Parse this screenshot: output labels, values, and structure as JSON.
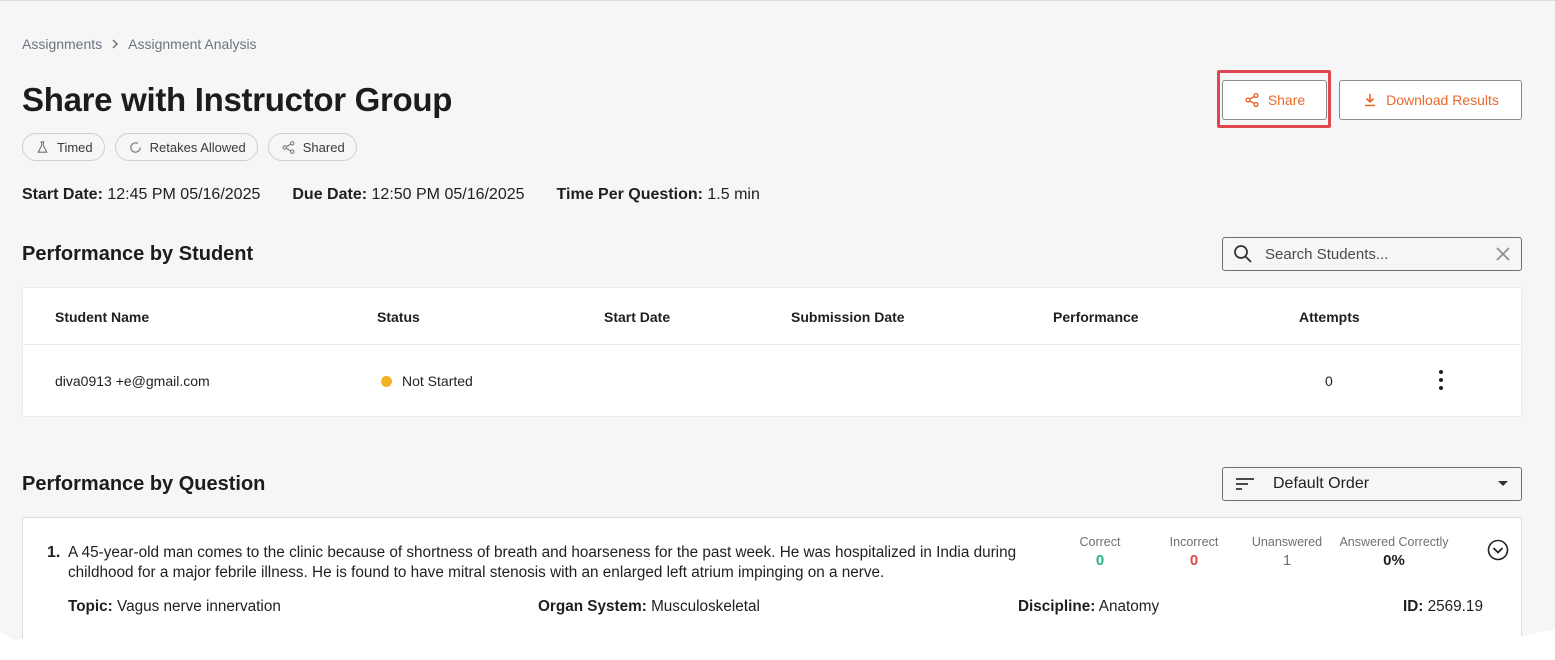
{
  "breadcrumb": {
    "parent": "Assignments",
    "separator": ">",
    "current": "Assignment Analysis"
  },
  "header": {
    "title": "Share with Instructor Group",
    "share_label": "Share",
    "download_label": "Download Results"
  },
  "chips": [
    {
      "label": "Timed",
      "icon": "flask-icon"
    },
    {
      "label": "Retakes Allowed",
      "icon": "refresh-icon"
    },
    {
      "label": "Shared",
      "icon": "share-icon"
    }
  ],
  "meta": {
    "start_label": "Start Date:",
    "start_value": "12:45 PM 05/16/2025",
    "due_label": "Due Date:",
    "due_value": "12:50 PM 05/16/2025",
    "tpq_label": "Time Per Question:",
    "tpq_value": "1.5 min"
  },
  "students_section": {
    "title": "Performance by Student",
    "search_placeholder": "Search Students...",
    "columns": [
      "Student Name",
      "Status",
      "Start Date",
      "Submission Date",
      "Performance",
      "Attempts"
    ],
    "rows": [
      {
        "name": "diva0913 +e@gmail.com",
        "status": "Not Started",
        "status_color": "#f5b324",
        "start_date": "",
        "submission_date": "",
        "performance": "",
        "attempts": "0"
      }
    ]
  },
  "questions_section": {
    "title": "Performance by Question",
    "sort_label": "Default Order",
    "questions": [
      {
        "number": "1.",
        "text": "A 45-year-old man comes to the clinic because of shortness of breath and hoarseness for the past week. He was hospitalized in India during childhood for a major febrile illness. He is found to have mitral stenosis with an enlarged left atrium impinging on a nerve.",
        "stats": {
          "correct_label": "Correct",
          "correct_value": "0",
          "correct_color": "#2bb38a",
          "incorrect_label": "Incorrect",
          "incorrect_value": "0",
          "incorrect_color": "#e0464f",
          "unanswered_label": "Unanswered",
          "unanswered_value": "1",
          "answered_correctly_label": "Answered Correctly",
          "answered_correctly_value": "0%"
        },
        "topic_label": "Topic:",
        "topic": "Vagus nerve innervation",
        "organ_label": "Organ System:",
        "organ": "Musculoskeletal",
        "discipline_label": "Discipline:",
        "discipline": "Anatomy",
        "id_label": "ID:",
        "id": "2569.19"
      }
    ]
  },
  "colors": {
    "accent": "#e8692b",
    "highlight": "#e0464f",
    "background": "#f6f6f6"
  }
}
